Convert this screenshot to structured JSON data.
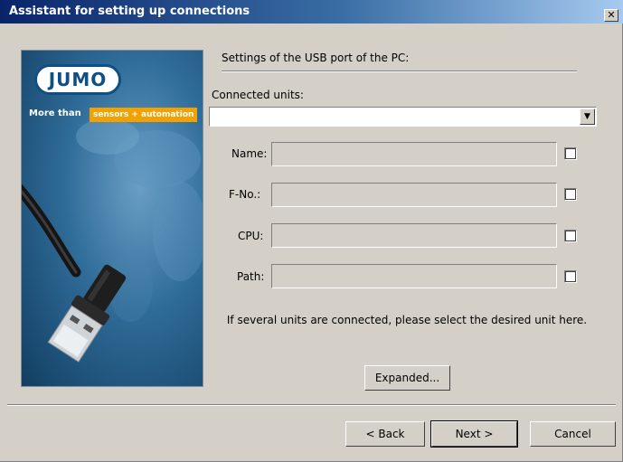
{
  "window": {
    "title": "Assistant for setting up connections",
    "close_glyph": "✕"
  },
  "brand": {
    "logo": "JUMO",
    "tagline_prefix": "More than",
    "tagline_highlight": "sensors + automation"
  },
  "main": {
    "section_title": "Settings of the USB port of the PC:",
    "connected_units_label": "Connected units:",
    "connected_units_value": "",
    "fields": [
      {
        "label": "Name:",
        "value": "",
        "checked": false
      },
      {
        "label": "F-No.:",
        "value": "",
        "checked": false
      },
      {
        "label": "CPU:",
        "value": "",
        "checked": false
      },
      {
        "label": "Path:",
        "value": "",
        "checked": false
      }
    ],
    "hint": "If several units are connected, please select the desired unit here.",
    "expanded_button": "Expanded..."
  },
  "footer": {
    "back": "< Back",
    "next": "Next >",
    "cancel": "Cancel"
  },
  "colors": {
    "title_bar_start": "#0a246a",
    "title_bar_end": "#a6caf0",
    "face": "#d4d0c8",
    "brand_blue": "#0e4f86",
    "brand_orange": "#f2a100"
  },
  "icons": [
    "close-icon",
    "dropdown-arrow-icon",
    "usb-cable-image"
  ]
}
